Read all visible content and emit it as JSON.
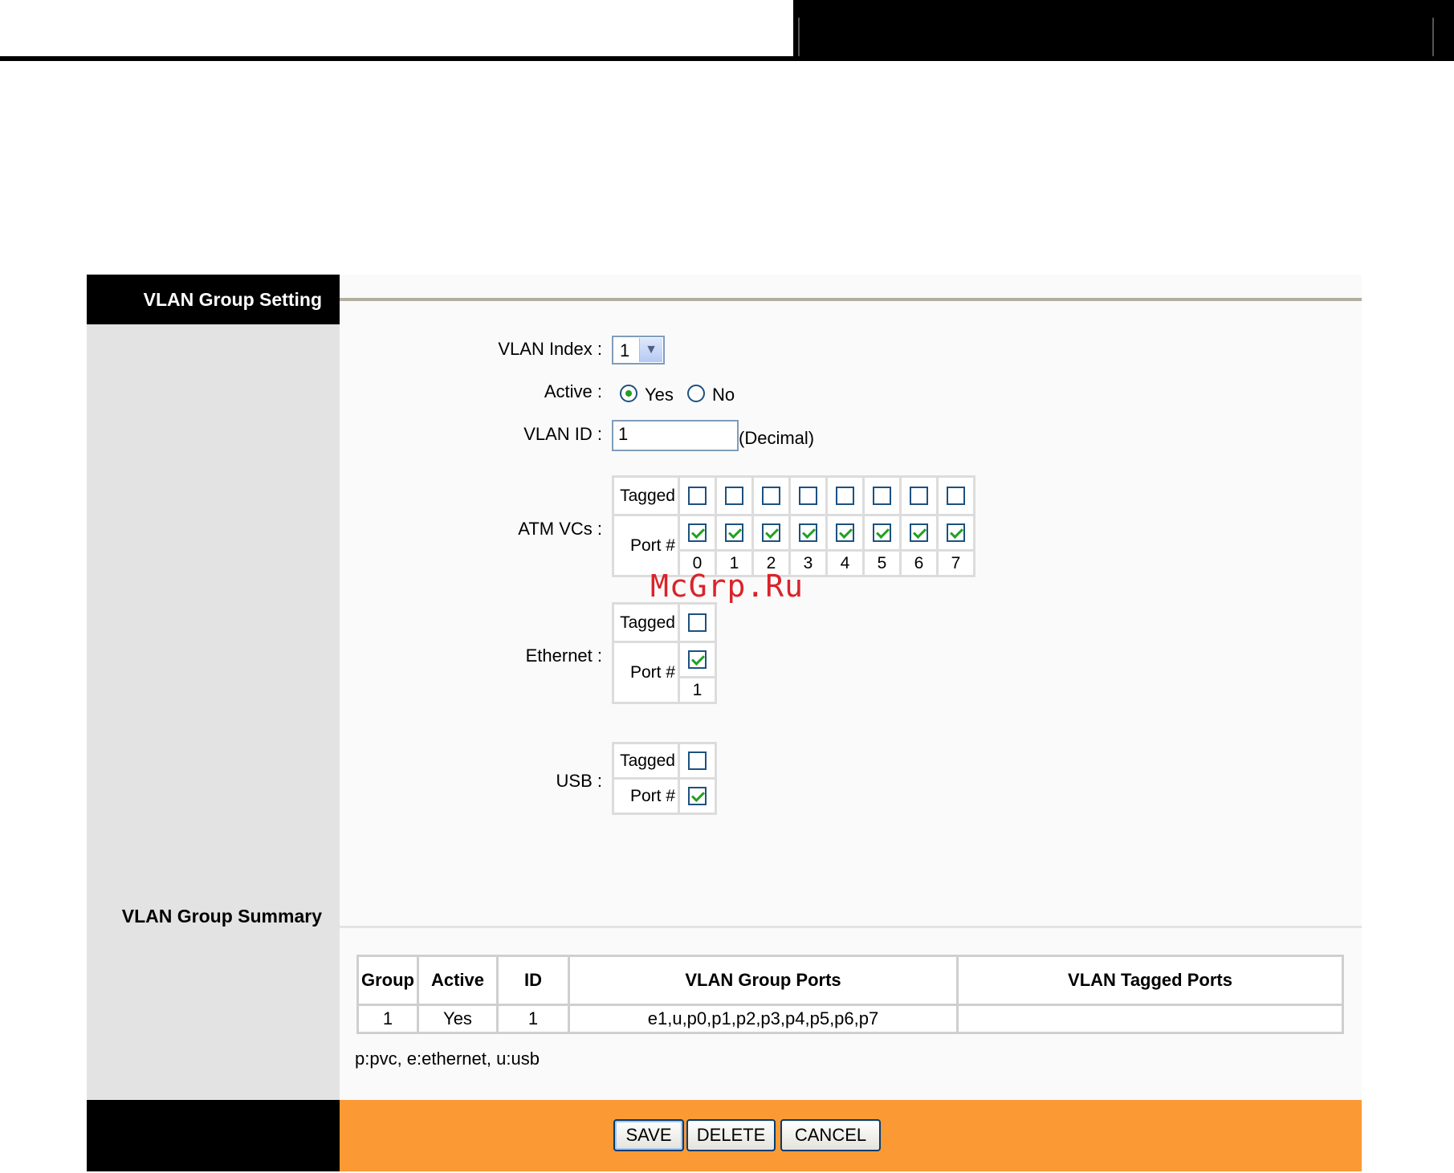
{
  "section_title": "VLAN Group Setting",
  "form": {
    "vlan_index_label": "VLAN Index :",
    "vlan_index_value": "1",
    "active_label": "Active :",
    "active_yes": "Yes",
    "active_no": "No",
    "active_selected": "Yes",
    "vlan_id_label": "VLAN ID :",
    "vlan_id_value": "1",
    "vlan_id_hint": "(Decimal)"
  },
  "atm": {
    "label": "ATM VCs :",
    "tagged_label": "Tagged",
    "port_label": "Port #",
    "ports": [
      "0",
      "1",
      "2",
      "3",
      "4",
      "5",
      "6",
      "7"
    ],
    "tagged": [
      false,
      false,
      false,
      false,
      false,
      false,
      false,
      false
    ],
    "member": [
      true,
      true,
      true,
      true,
      true,
      true,
      true,
      true
    ]
  },
  "ethernet": {
    "label": "Ethernet :",
    "tagged_label": "Tagged",
    "port_label": "Port #",
    "port": "1",
    "tagged": false,
    "member": true
  },
  "usb": {
    "label": "USB :",
    "tagged_label": "Tagged",
    "port_label": "Port #",
    "tagged": false,
    "member": true
  },
  "summary": {
    "title": "VLAN Group Summary",
    "columns": [
      "Group",
      "Active",
      "ID",
      "VLAN Group Ports",
      "VLAN Tagged Ports"
    ],
    "rows": [
      [
        "1",
        "Yes",
        "1",
        "e1,u,p0,p1,p2,p3,p4,p5,p6,p7",
        ""
      ]
    ],
    "legend": "p:pvc, e:ethernet, u:usb"
  },
  "buttons": {
    "save": "SAVE",
    "delete": "DELETE",
    "cancel": "CANCEL"
  },
  "watermark": "McGrp.Ru",
  "colors": {
    "footer_orange": "#fb9a34",
    "sidebar_gray": "#e3e3e3",
    "check_green": "#21a121"
  }
}
